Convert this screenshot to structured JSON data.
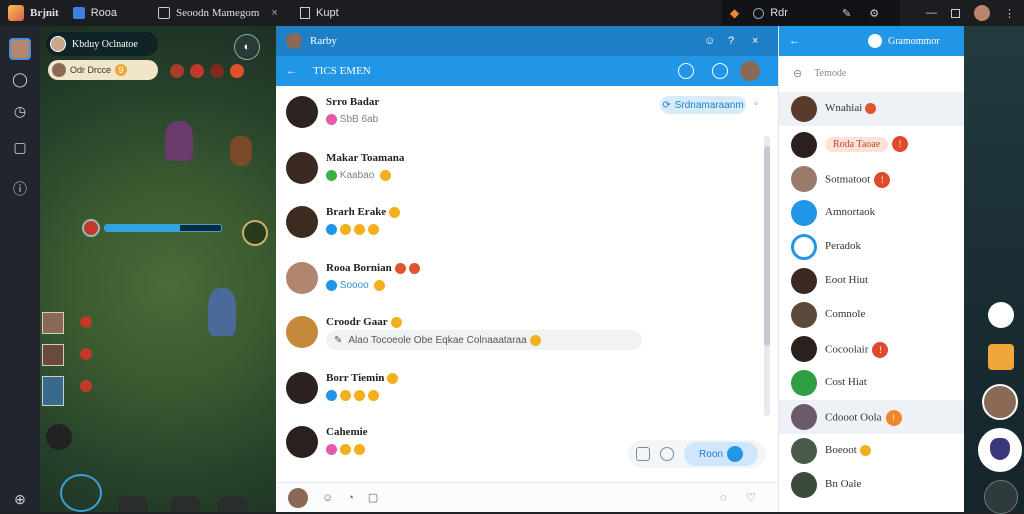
{
  "topbar": {
    "app_name": "Brjnit",
    "tab1_label": "Rooa",
    "tab2_label": "Seoodn Mamegom",
    "tab3_label": "Kupt",
    "search_value": "Rdr"
  },
  "game": {
    "player_name": "Kbduy Oclnatoe",
    "sub_name": "Odr Drcce",
    "sub_value": "9"
  },
  "chat": {
    "window_title": "Rarby",
    "channel_title": "TICS EMEN",
    "pinned_pill": "Srdnamaraanm",
    "messages": [
      {
        "name": "Srro Badar",
        "text": "SbB 6ab"
      },
      {
        "name": "Makar Toamana",
        "text": "Kaabao"
      },
      {
        "name": "Brarh Erake",
        "text": ""
      },
      {
        "name": "Rooa Bornian",
        "text": "Soooo"
      },
      {
        "name": "Croodr Gaar",
        "text": "Alao Tocoeole Obe Eqkae Colnaaataraa"
      },
      {
        "name": "Borr Tiemin",
        "text": ""
      },
      {
        "name": "Cahemie",
        "text": ""
      }
    ],
    "send_label": "Roon"
  },
  "contacts": {
    "title": "Gramommor",
    "search_placeholder": "Temode",
    "items": [
      {
        "name": "Wnahiai",
        "badge": "",
        "pill": ""
      },
      {
        "name": "",
        "badge": "",
        "pill": "Roda Taoae"
      },
      {
        "name": "Sotmatoot",
        "badge": "",
        "pill": ""
      },
      {
        "name": "Amnortaok",
        "badge": "",
        "pill": ""
      },
      {
        "name": "Peradok",
        "badge": "",
        "pill": ""
      },
      {
        "name": "Eoot Hiut",
        "badge": "",
        "pill": ""
      },
      {
        "name": "Comnole",
        "badge": "",
        "pill": ""
      },
      {
        "name": "Cocoolair",
        "badge": "",
        "pill": ""
      },
      {
        "name": "Cost Hiat",
        "badge": "",
        "pill": ""
      },
      {
        "name": "Cdooot Oola",
        "badge": "",
        "pill": ""
      },
      {
        "name": "Boeoot",
        "badge": "",
        "pill": ""
      },
      {
        "name": "Bn Oale",
        "badge": "",
        "pill": ""
      }
    ]
  }
}
